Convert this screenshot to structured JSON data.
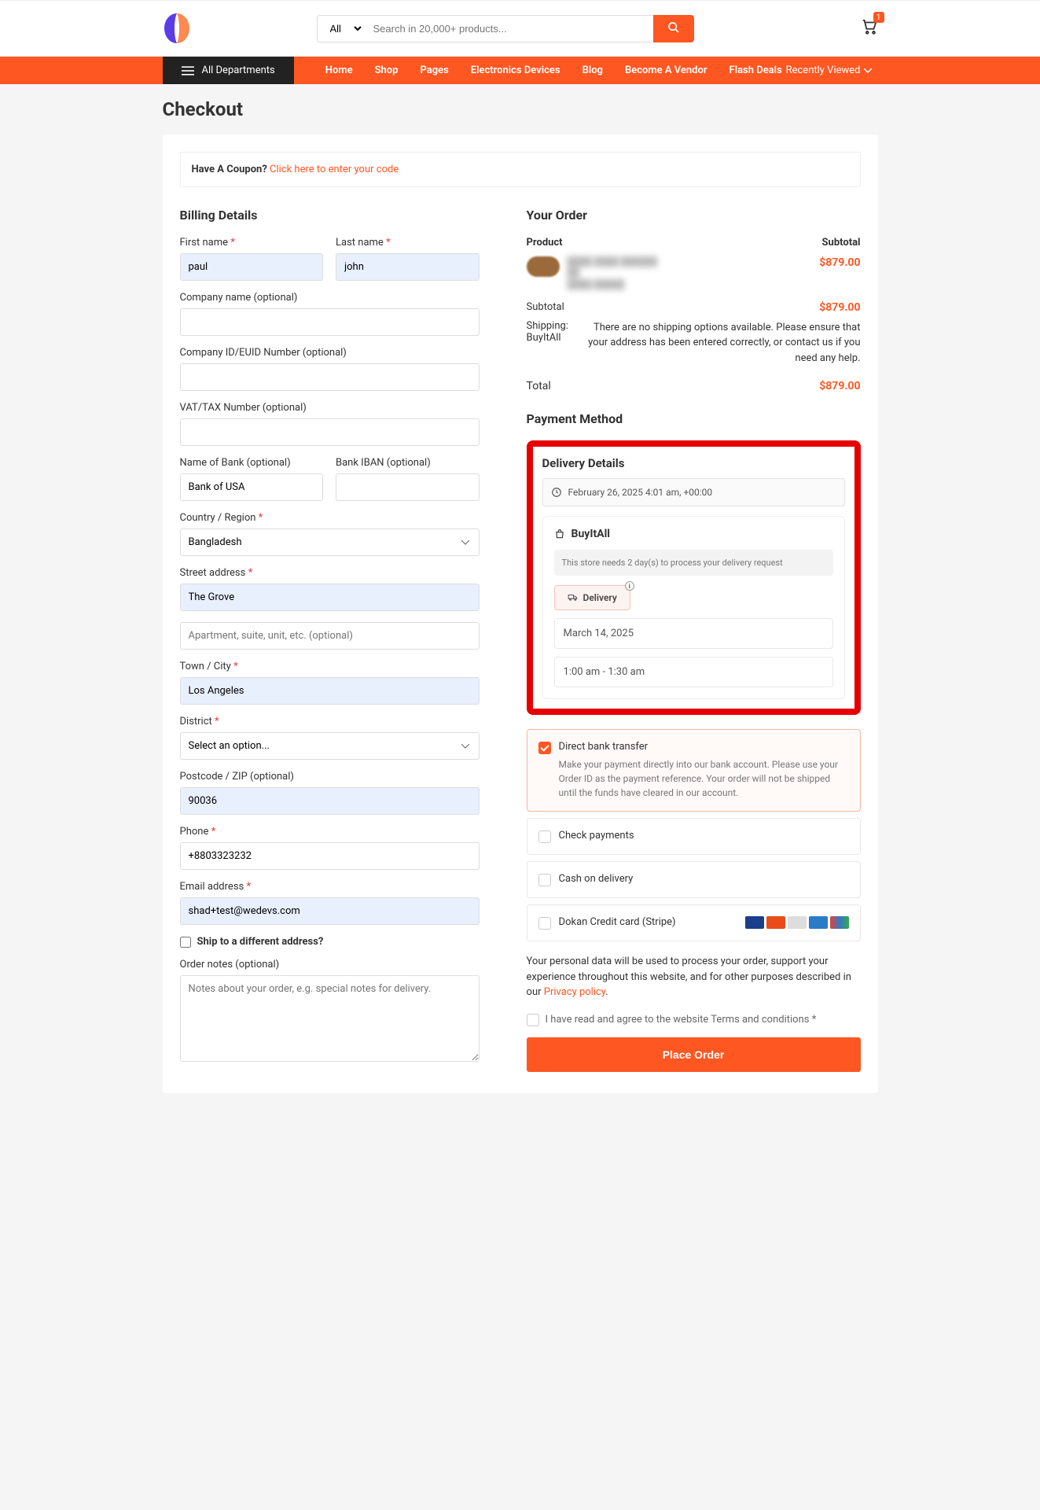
{
  "header": {
    "search_category": "All",
    "search_placeholder": "Search in 20,000+ products...",
    "cart_count": "1",
    "all_departments": "All Departments",
    "nav": [
      "Home",
      "Shop",
      "Pages",
      "Electronics Devices",
      "Blog",
      "Become A Vendor",
      "Flash Deals"
    ],
    "recently_viewed": "Recently Viewed"
  },
  "page": {
    "title": "Checkout"
  },
  "coupon": {
    "question": "Have A Coupon?",
    "link": "Click here to enter your code"
  },
  "billing": {
    "heading": "Billing Details",
    "labels": {
      "first_name": "First name",
      "last_name": "Last name",
      "company": "Company name (optional)",
      "company_id": "Company ID/EUID Number (optional)",
      "vat": "VAT/TAX Number (optional)",
      "bank_name": "Name of Bank (optional)",
      "bank_iban": "Bank IBAN (optional)",
      "country": "Country / Region",
      "street": "Street address",
      "street2_placeholder": "Apartment, suite, unit, etc. (optional)",
      "city": "Town / City",
      "district": "District",
      "district_placeholder": "Select an option...",
      "postcode": "Postcode / ZIP (optional)",
      "phone": "Phone",
      "email": "Email address",
      "ship_different": "Ship to a different address?",
      "order_notes": "Order notes (optional)",
      "notes_placeholder": "Notes about your order, e.g. special notes for delivery."
    },
    "values": {
      "first_name": "paul",
      "last_name": "john",
      "company": "",
      "company_id": "",
      "vat": "",
      "bank_name": "Bank of USA",
      "bank_iban": "",
      "country": "Bangladesh",
      "street": "The Grove",
      "street2": "",
      "city": "Los Angeles",
      "postcode": "90036",
      "phone": "+8803323232",
      "email": "shad+test@wedevs.com"
    }
  },
  "order": {
    "heading": "Your Order",
    "product_col": "Product",
    "subtotal_col": "Subtotal",
    "item_price": "$879.00",
    "subtotal_label": "Subtotal",
    "subtotal_value": "$879.00",
    "shipping_label": "Shipping: BuyItAll",
    "shipping_msg": "There are no shipping options available. Please ensure that your address has been entered correctly, or contact us if you need any help.",
    "total_label": "Total",
    "total_value": "$879.00"
  },
  "payment": {
    "heading": "Payment Method"
  },
  "delivery": {
    "heading": "Delivery Details",
    "current_time": "February 26, 2025 4:01 am, +00:00",
    "vendor": "BuyItAll",
    "notice": "This store needs 2 day(s) to process your delivery request",
    "badge": "Delivery",
    "slot_date": "March 14, 2025",
    "slot_time": "1:00 am - 1:30 am"
  },
  "pay_options": {
    "bank": "Direct bank transfer",
    "bank_desc": "Make your payment directly into our bank account. Please use your Order ID as the payment reference. Your order will not be shipped until the funds have cleared in our account.",
    "check": "Check payments",
    "cod": "Cash on delivery",
    "stripe": "Dokan Credit card (Stripe)"
  },
  "footer": {
    "privacy_text": "Your personal data will be used to process your order, support your experience throughout this website, and for other purposes described in our ",
    "privacy_link": "Privacy policy",
    "terms_prefix": "I have read and agree to the website ",
    "terms_link": "Terms and conditions",
    "place_order": "Place Order"
  }
}
